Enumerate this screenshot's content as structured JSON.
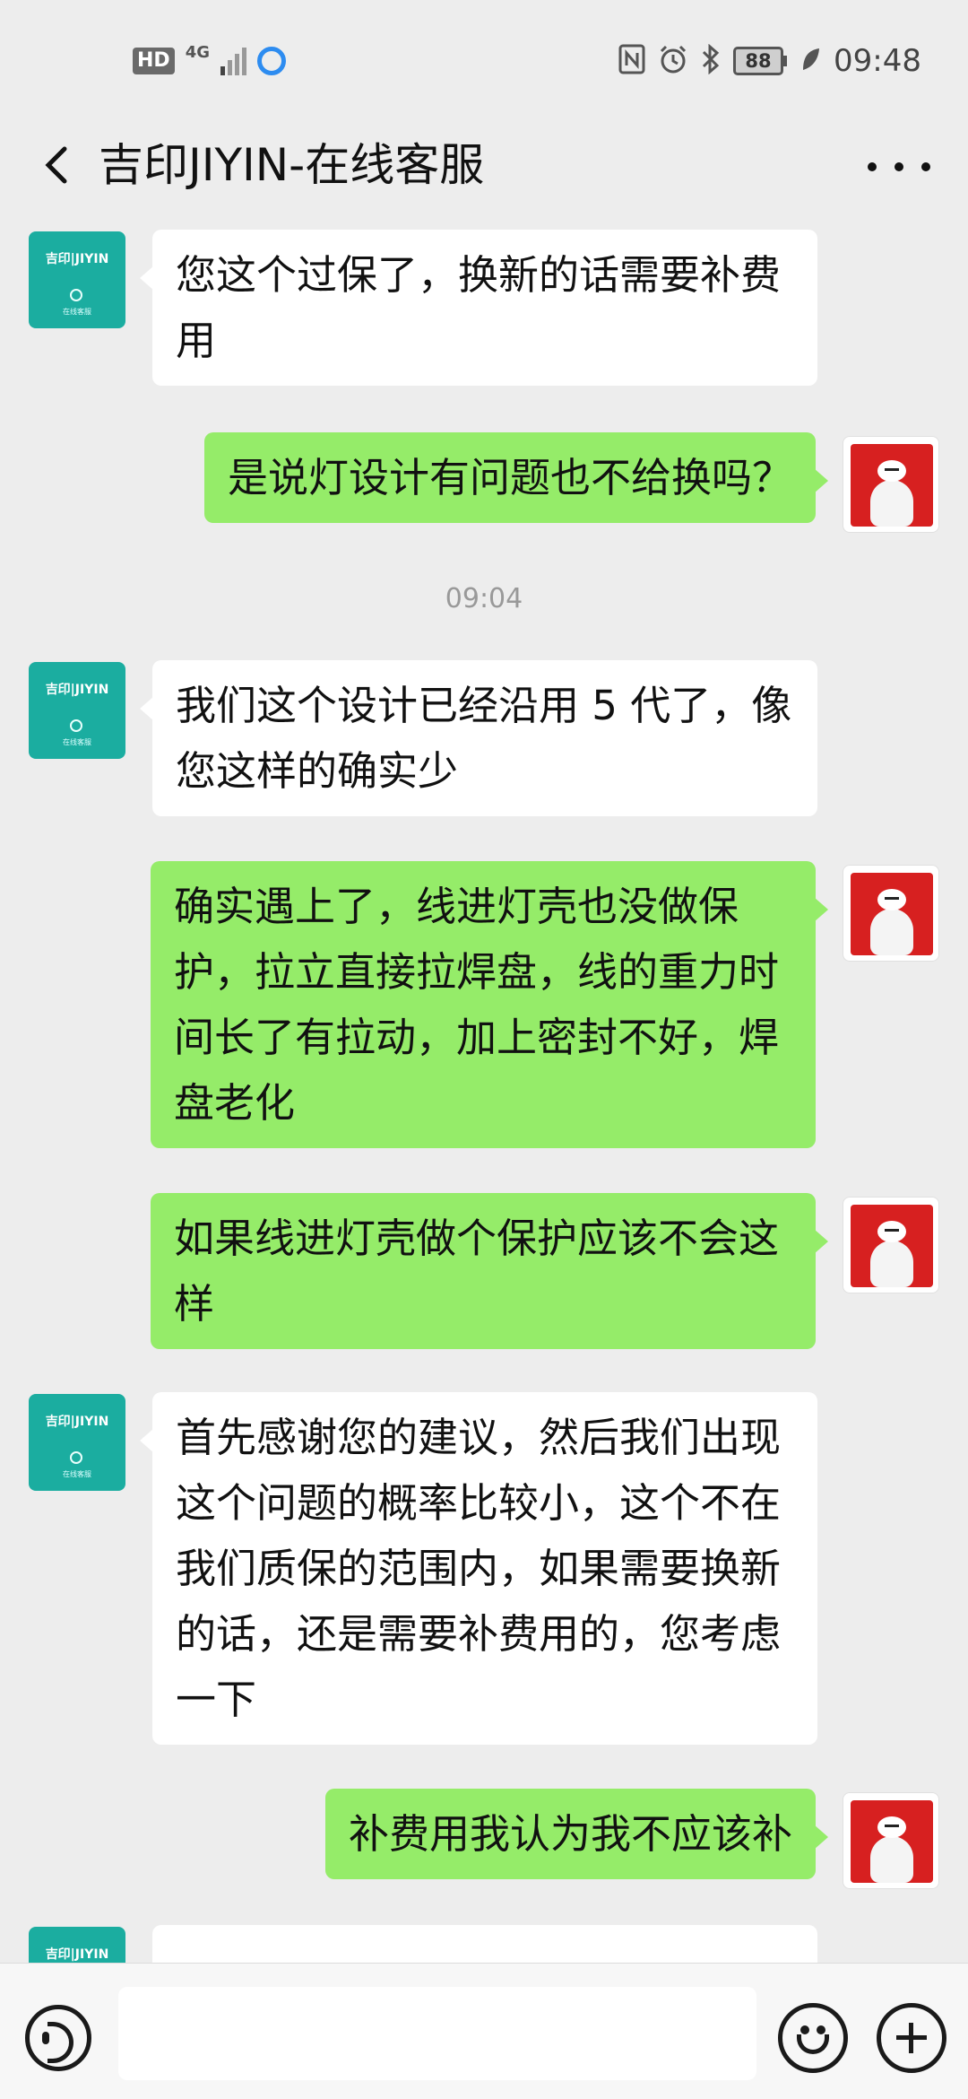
{
  "status_bar": {
    "hd": "HD",
    "network": "4G",
    "battery": "88",
    "time": "09:48",
    "icons": [
      "nfc-icon",
      "alarm-icon",
      "bluetooth-icon",
      "leaf-icon"
    ]
  },
  "header": {
    "title": "吉印JIYIN-在线客服",
    "back_icon": "chevron-left-icon",
    "more_icon": "more-icon"
  },
  "agent_avatar": {
    "logo_text": "吉印|JIYIN",
    "sub_text": "在线客服"
  },
  "messages": [
    {
      "side": "left",
      "text": "您这个过保了，换新的话需要补费用"
    },
    {
      "side": "right",
      "text": "是说灯设计有问题也不给换吗？"
    },
    {
      "type": "time",
      "text": "09:04"
    },
    {
      "side": "left",
      "text": "我们这个设计已经沿用 5 代了，像您这样的确实少"
    },
    {
      "side": "right",
      "text": "确实遇上了，线进灯壳也没做保护，拉立直接拉焊盘，线的重力时间长了有拉动，加上密封不好，焊盘老化"
    },
    {
      "side": "right",
      "text": "如果线进灯壳做个保护应该不会这样"
    },
    {
      "side": "left",
      "text": "首先感谢您的建议，然后我们出现这个问题的概率比较小，这个不在我们质保的范围内，如果需要换新的话，还是需要补费用的，您考虑一下"
    },
    {
      "side": "right",
      "text": "补费用我认为我不应该补"
    }
  ],
  "input_bar": {
    "voice_icon": "voice-icon",
    "emoji_icon": "emoji-icon",
    "plus_icon": "plus-icon",
    "text_value": ""
  },
  "colors": {
    "background": "#ededed",
    "self_bubble": "#95ec69",
    "other_bubble": "#ffffff",
    "agent_avatar": "#1bada0",
    "user_avatar": "#d72020"
  }
}
